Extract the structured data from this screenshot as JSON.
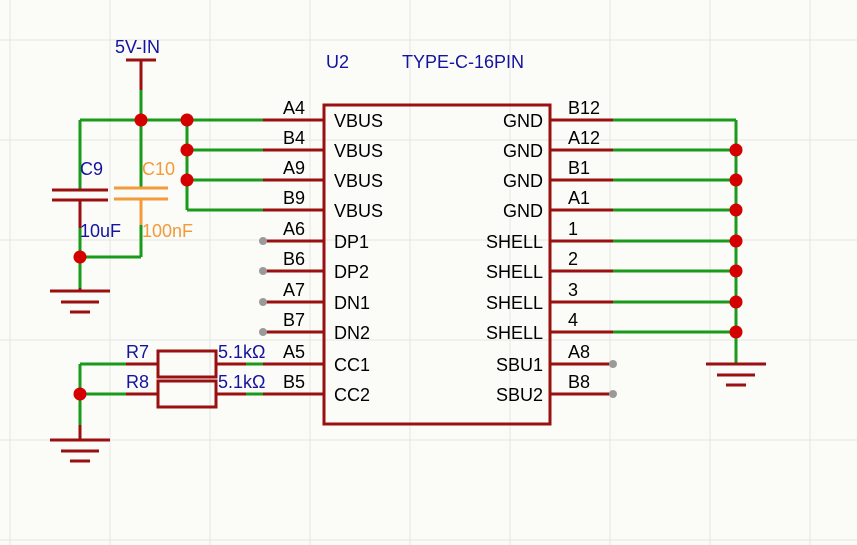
{
  "colors": {
    "background": "#fbfbf8",
    "grid": "#e6e6e0",
    "wire": "#1a9a1a",
    "part": "#9a1010",
    "junction": "#d40000",
    "text": "#000000",
    "designator": "#1414a0",
    "cap_label": "#f39a3a",
    "nc_dot": "#9a9a9a"
  },
  "power": {
    "label": "5V-IN"
  },
  "connector": {
    "designator": "U2",
    "value": "TYPE-C-16PIN",
    "left_pins": [
      {
        "pin": "A4",
        "name": "VBUS"
      },
      {
        "pin": "B4",
        "name": "VBUS"
      },
      {
        "pin": "A9",
        "name": "VBUS"
      },
      {
        "pin": "B9",
        "name": "VBUS"
      },
      {
        "pin": "A6",
        "name": "DP1"
      },
      {
        "pin": "B6",
        "name": "DP2"
      },
      {
        "pin": "A7",
        "name": "DN1"
      },
      {
        "pin": "B7",
        "name": "DN2"
      },
      {
        "pin": "A5",
        "name": "CC1"
      },
      {
        "pin": "B5",
        "name": "CC2"
      }
    ],
    "right_pins": [
      {
        "pin": "B12",
        "name": "GND"
      },
      {
        "pin": "A12",
        "name": "GND"
      },
      {
        "pin": "B1",
        "name": "GND"
      },
      {
        "pin": "A1",
        "name": "GND"
      },
      {
        "pin": "1",
        "name": "SHELL"
      },
      {
        "pin": "2",
        "name": "SHELL"
      },
      {
        "pin": "3",
        "name": "SHELL"
      },
      {
        "pin": "4",
        "name": "SHELL"
      },
      {
        "pin": "A8",
        "name": "SBU1"
      },
      {
        "pin": "B8",
        "name": "SBU2"
      }
    ]
  },
  "capacitors": [
    {
      "designator": "C9",
      "value": "10uF"
    },
    {
      "designator": "C10",
      "value": "100nF"
    }
  ],
  "resistors": [
    {
      "designator": "R7",
      "value": "5.1kΩ"
    },
    {
      "designator": "R8",
      "value": "5.1kΩ"
    }
  ]
}
